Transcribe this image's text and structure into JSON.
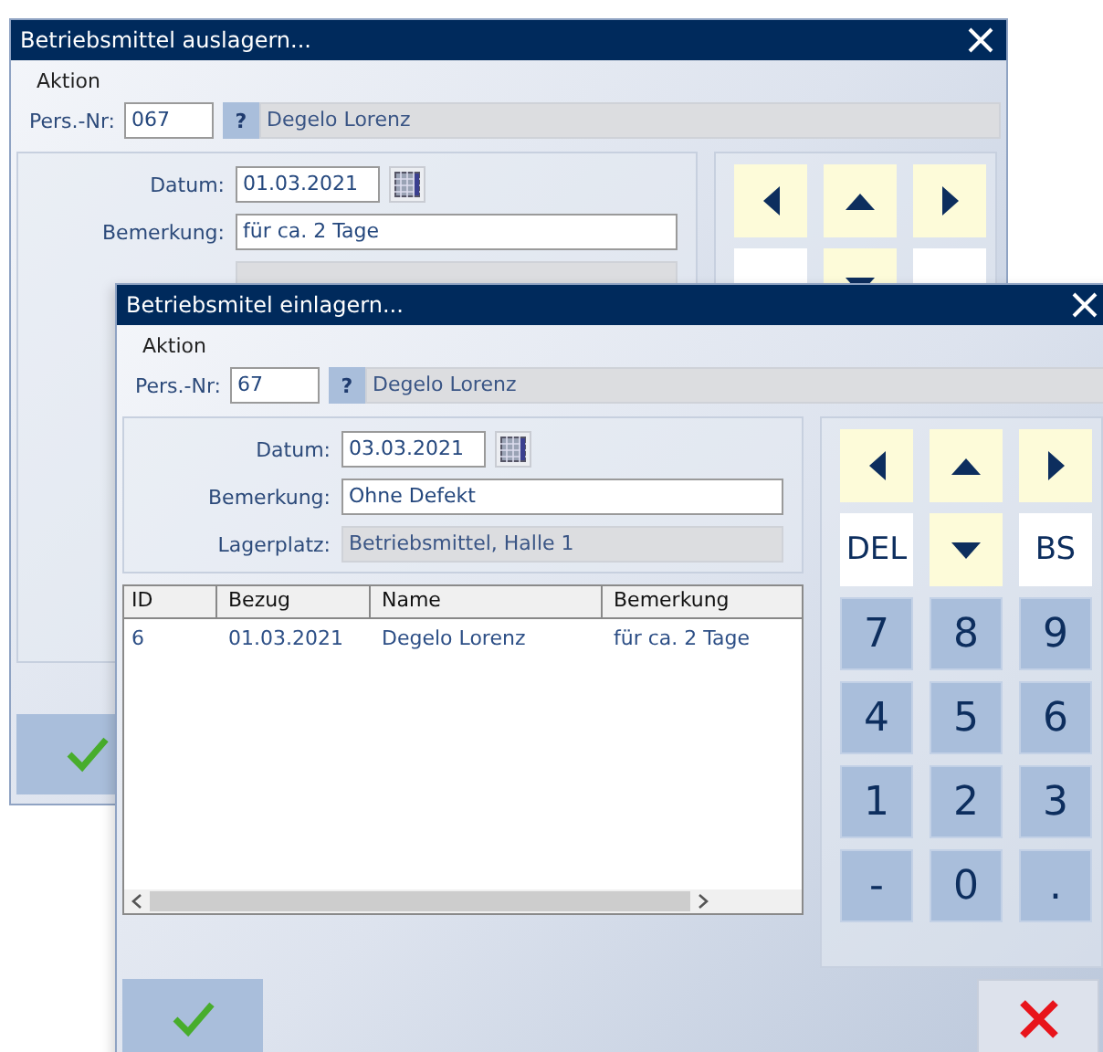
{
  "windows": [
    {
      "title": "Betriebsmittel auslagern...",
      "menu": "Aktion",
      "pers_label": "Pers.-Nr:",
      "pers_nr": "067",
      "lookup": "?",
      "person": "Degelo Lorenz",
      "fields": [
        {
          "kind": "date",
          "label": "Datum:",
          "value": "01.03.2021"
        },
        {
          "kind": "input",
          "label": "Bemerkung:",
          "value": "für ca. 2 Tage"
        }
      ],
      "keys": [
        {
          "kind": "left"
        },
        {
          "kind": "up"
        },
        {
          "kind": "right"
        },
        {
          "kind": "edit"
        },
        {
          "kind": "down"
        },
        {
          "kind": "edit"
        }
      ],
      "buttons": [
        {
          "kind": "ok"
        }
      ]
    },
    {
      "title": "Betriebsmitel einlagern...",
      "menu": "Aktion",
      "pers_label": "Pers.-Nr:",
      "pers_nr": "67",
      "lookup": "?",
      "person": "Degelo Lorenz",
      "fields": [
        {
          "kind": "date",
          "label": "Datum:",
          "value": "03.03.2021"
        },
        {
          "kind": "input",
          "label": "Bemerkung:",
          "value": "Ohne Defekt"
        },
        {
          "kind": "readonly",
          "label": "Lagerplatz:",
          "value": "Betriebsmittel, Halle 1"
        }
      ],
      "table": {
        "columns": [
          "ID",
          "Bezug",
          "Name",
          "Bemerkung"
        ],
        "rows": [
          [
            "6",
            "01.03.2021",
            "Degelo Lorenz",
            "für ca. 2 Tage"
          ]
        ]
      },
      "keys": [
        {
          "kind": "left"
        },
        {
          "kind": "up"
        },
        {
          "kind": "right"
        },
        {
          "kind": "edit",
          "label": "DEL"
        },
        {
          "kind": "down"
        },
        {
          "kind": "edit",
          "label": "BS"
        },
        {
          "kind": "digit",
          "label": "7"
        },
        {
          "kind": "digit",
          "label": "8"
        },
        {
          "kind": "digit",
          "label": "9"
        },
        {
          "kind": "digit",
          "label": "4"
        },
        {
          "kind": "digit",
          "label": "5"
        },
        {
          "kind": "digit",
          "label": "6"
        },
        {
          "kind": "digit",
          "label": "1"
        },
        {
          "kind": "digit",
          "label": "2"
        },
        {
          "kind": "digit",
          "label": "3"
        },
        {
          "kind": "digit",
          "label": "-"
        },
        {
          "kind": "digit",
          "label": "0"
        },
        {
          "kind": "digit",
          "label": "."
        }
      ],
      "buttons": [
        {
          "kind": "ok"
        },
        {
          "kind": "cancel"
        }
      ]
    }
  ]
}
